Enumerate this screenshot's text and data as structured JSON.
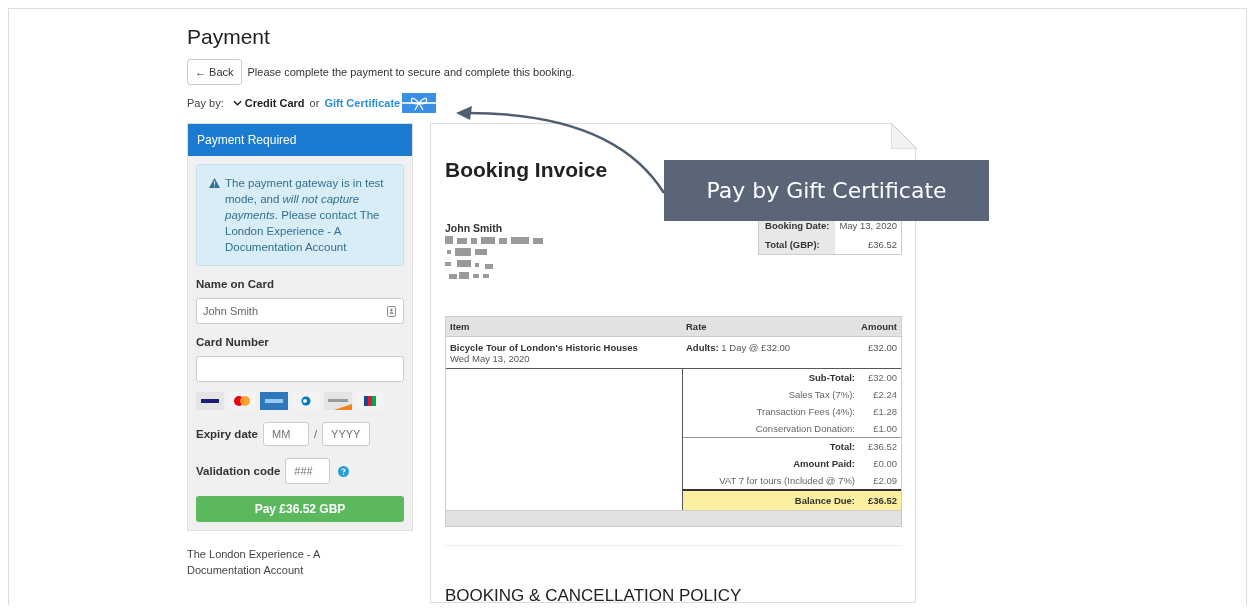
{
  "page_title": "Payment",
  "back_button": "← Back",
  "intro": "Please complete the payment to secure and complete this booking.",
  "pay_by": {
    "label": "Pay by:",
    "credit_card": {
      "label": "Credit Card",
      "expanded": true
    },
    "separator": "or",
    "gift_certificate": "Gift Certificate"
  },
  "payment_panel": {
    "header": "Payment Required",
    "alert": "The payment gateway is in test mode, and *will not capture payments*. Please contact The London Experience - A Documentation Account",
    "name_label": "Name on Card",
    "name_value": "John Smith",
    "card_label": "Card Number",
    "expiry_label": "Expiry date",
    "month_placeholder": "MM",
    "date_separator": "/",
    "year_placeholder": "YYYY",
    "cvv_label": "Validation code",
    "cvv_placeholder": "###",
    "pay_button": "Pay £36.52 GBP"
  },
  "merchant": "The London Experience - A Documentation Account",
  "invoice": {
    "title": "Booking Invoice",
    "customer": "John Smith",
    "summary": [
      {
        "label": "Booking Date:",
        "value": "May 13, 2020"
      },
      {
        "label": "Total (GBP):",
        "value": "£36.52"
      }
    ],
    "columns": [
      "Item",
      "Rate",
      "Amount"
    ],
    "items": [
      {
        "name": "Bicycle Tour of London's Historic Houses",
        "date": "Wed May 13, 2020",
        "rate": "**Adults:** 1 Day @ £32.00",
        "amount": "£32.00"
      }
    ],
    "totals": [
      {
        "kind": "bold",
        "label": "Sub-Total:",
        "value": "£32.00"
      },
      {
        "kind": "plain",
        "label": "Sales Tax (7%):",
        "value": "£2.24"
      },
      {
        "kind": "plain",
        "label": "Transaction Fees (4%):",
        "value": "£1.28"
      },
      {
        "kind": "plain",
        "label": "Conservation Donation:",
        "value": "£1.00"
      },
      {
        "kind": "bold",
        "label": "Total:",
        "value": "£36.52"
      },
      {
        "kind": "bold",
        "label": "Amount Paid:",
        "value": "£0.00"
      },
      {
        "kind": "plain",
        "label": "VAT 7 for tours (Included @ 7%)",
        "value": "£2.09"
      },
      {
        "kind": "balance",
        "label": "Balance Due:",
        "value": "£36.52"
      }
    ],
    "policy_heading": "BOOKING & CANCELLATION POLICY"
  },
  "callout": "Pay by Gift Certificate"
}
